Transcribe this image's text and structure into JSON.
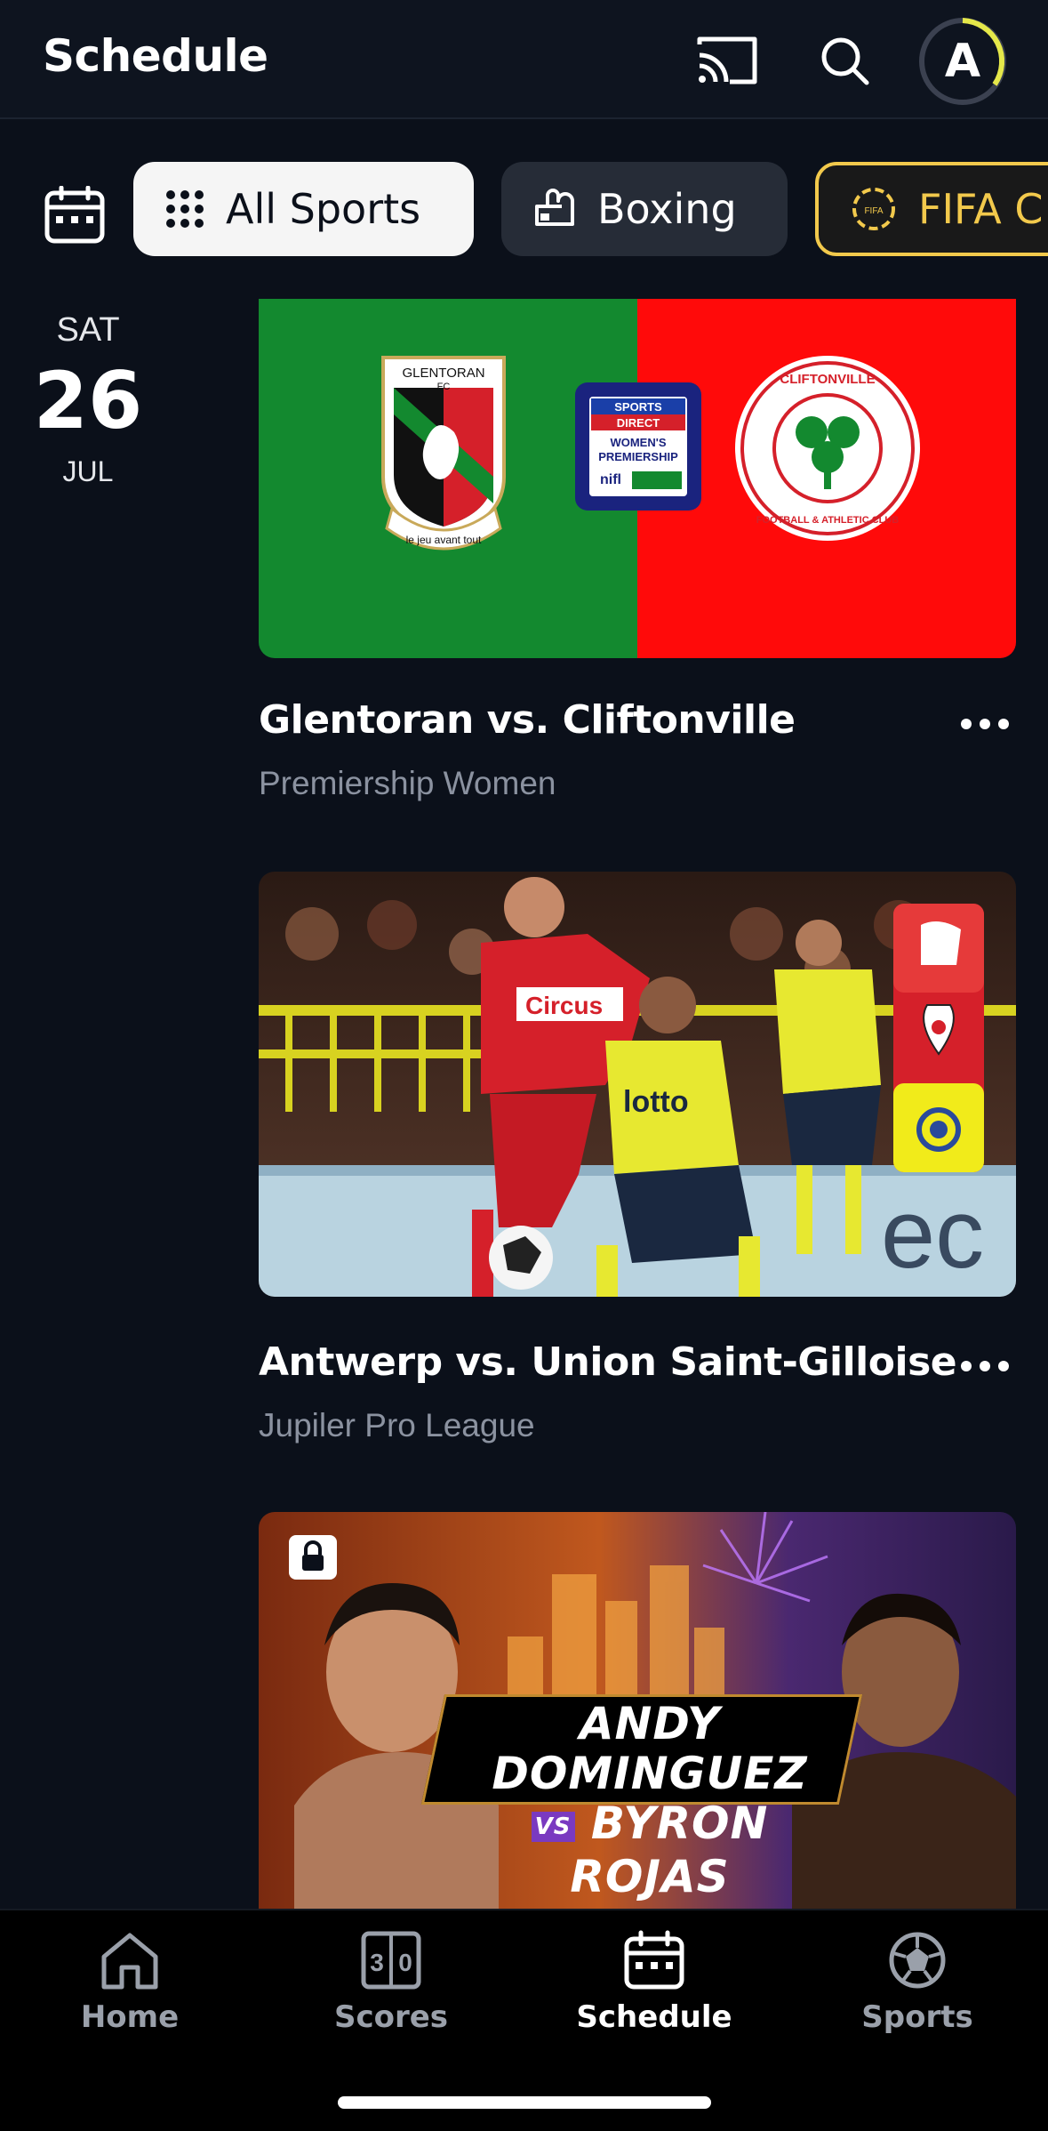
{
  "header": {
    "title": "Schedule",
    "avatar_letter": "A"
  },
  "filters": {
    "chips": [
      {
        "label": "All Sports"
      },
      {
        "label": "Boxing"
      },
      {
        "label": "FIFA C"
      }
    ]
  },
  "date": {
    "day_of_week": "SAT",
    "day": "26",
    "month": "JUL"
  },
  "events": [
    {
      "title": "Glentoran vs. Cliftonville",
      "subtitle": "Premiership Women",
      "home_badge_text": "GLENTORAN",
      "home_badge_sub": "FC",
      "home_badge_motto": "le jeu avant tout",
      "league_badge_lines": [
        "SPORTS",
        "DIRECT",
        "WOMEN'S",
        "PREMIERSHIP",
        "nifl"
      ],
      "away_badge_top": "CLIFTONVILLE",
      "away_badge_bottom": "FOOTBALL & ATHLETIC CLUB",
      "home_color": "#13892f",
      "away_color": "#ff0a0a"
    },
    {
      "title": "Antwerp vs. Union Saint-Gilloise",
      "subtitle": "Jupiler Pro League",
      "jersey_text_1": "Circus",
      "jersey_text_2": "lotto"
    },
    {
      "title_line_1": "ANDY DOMINGUEZ",
      "title_line_2": "BYRON ROJAS",
      "vs": "VS",
      "locked": true
    }
  ],
  "nav": {
    "items": [
      {
        "label": "Home"
      },
      {
        "label": "Scores"
      },
      {
        "label": "Schedule"
      },
      {
        "label": "Sports"
      }
    ],
    "active": "Schedule"
  },
  "colors": {
    "background": "#0b101a",
    "accent_yellow": "#f2c94c",
    "avatar_ring": "#e5e84a"
  }
}
